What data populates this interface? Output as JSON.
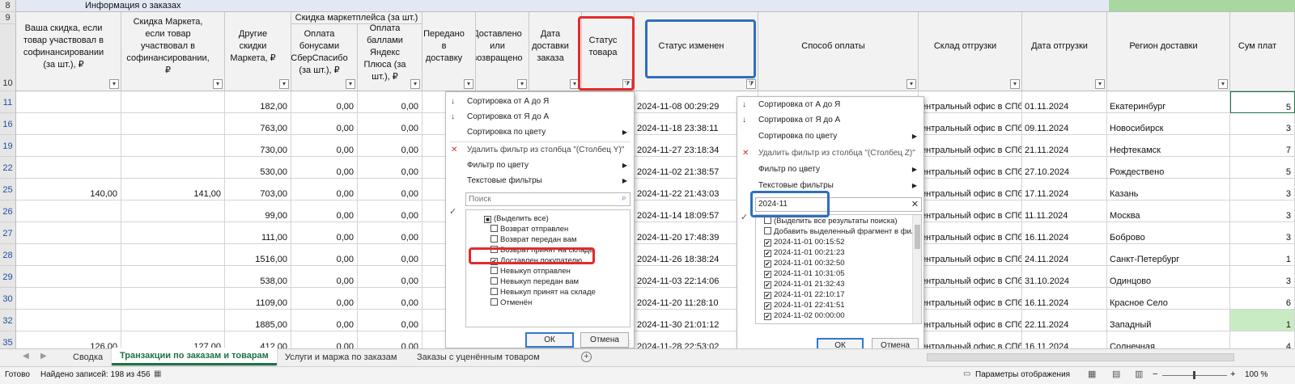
{
  "title_row": {
    "label": "Информация о заказах",
    "row_header": "8"
  },
  "row_headers": {
    "r9": "9",
    "r10": "10"
  },
  "group_header": "Скидка маркетплейса (за шт.)",
  "columns": [
    {
      "label": "Ваша скидка, если товар участвовал в софинансировании (за шт.), ₽"
    },
    {
      "label": "Скидка Маркета, если товар участвовал в софинансировании, ₽"
    },
    {
      "label": "Другие скидки Маркета, ₽"
    },
    {
      "label": "Оплата бонусами СберСпасибо (за шт.), ₽"
    },
    {
      "label": "Оплата баллами Яндекс Плюса (за шт.), ₽"
    },
    {
      "label": "Передано в доставку"
    },
    {
      "label": "Доставлено или возвращено"
    },
    {
      "label": "Дата доставки заказа"
    },
    {
      "label": "Статус товара"
    },
    {
      "label": "Статус изменен"
    },
    {
      "label": "Способ оплаты"
    },
    {
      "label": "Склад отгрузки"
    },
    {
      "label": "Дата отгрузки"
    },
    {
      "label": "Регион доставки"
    },
    {
      "label": "Сум плат"
    }
  ],
  "rows": [
    {
      "num": "11",
      "c1": "",
      "c2": "",
      "c3": "182,00",
      "c4": "0,00",
      "c5": "0,00",
      "changed": "2024-11-08 00:29:29",
      "warehouse": "ентральный офис в СПб",
      "ship": "01.11.2024",
      "region": "Екатеринбург",
      "sum": "5"
    },
    {
      "num": "16",
      "c1": "",
      "c2": "",
      "c3": "763,00",
      "c4": "0,00",
      "c5": "0,00",
      "changed": "2024-11-18 23:38:11",
      "warehouse": "ентральный офис в СПб",
      "ship": "09.11.2024",
      "region": "Новосибирск",
      "sum": "3"
    },
    {
      "num": "19",
      "c1": "",
      "c2": "",
      "c3": "730,00",
      "c4": "0,00",
      "c5": "0,00",
      "changed": "2024-11-27 23:18:34",
      "warehouse": "ентральный офис в СПб",
      "ship": "21.11.2024",
      "region": "Нефтекамск",
      "sum": "7"
    },
    {
      "num": "22",
      "c1": "",
      "c2": "",
      "c3": "530,00",
      "c4": "0,00",
      "c5": "0,00",
      "changed": "2024-11-02 21:38:57",
      "warehouse": "ентральный офис в СПб",
      "ship": "27.10.2024",
      "region": "Рождествено",
      "sum": "5"
    },
    {
      "num": "25",
      "c1": "140,00",
      "c2": "141,00",
      "c3": "703,00",
      "c4": "0,00",
      "c5": "0,00",
      "changed": "2024-11-22 21:43:03",
      "warehouse": "ентральный офис в СПб",
      "ship": "17.11.2024",
      "region": "Казань",
      "sum": "3"
    },
    {
      "num": "26",
      "c1": "",
      "c2": "",
      "c3": "99,00",
      "c4": "0,00",
      "c5": "0,00",
      "changed": "2024-11-14 18:09:57",
      "warehouse": "ентральный офис в СПб",
      "ship": "11.11.2024",
      "region": "Москва",
      "sum": "3"
    },
    {
      "num": "27",
      "c1": "",
      "c2": "",
      "c3": "111,00",
      "c4": "0,00",
      "c5": "0,00",
      "changed": "2024-11-20 17:48:39",
      "warehouse": "ентральный офис в СПб",
      "ship": "16.11.2024",
      "region": "Боброво",
      "sum": "3"
    },
    {
      "num": "28",
      "c1": "",
      "c2": "",
      "c3": "1516,00",
      "c4": "0,00",
      "c5": "0,00",
      "changed": "2024-11-26 18:38:24",
      "warehouse": "ентральный офис в СПб",
      "ship": "24.11.2024",
      "region": "Санкт-Петербург",
      "sum": "1"
    },
    {
      "num": "29",
      "c1": "",
      "c2": "",
      "c3": "538,00",
      "c4": "0,00",
      "c5": "0,00",
      "changed": "2024-11-03 22:14:06",
      "warehouse": "ентральный офис в СПб",
      "ship": "31.10.2024",
      "region": "Одинцово",
      "sum": "3"
    },
    {
      "num": "30",
      "c1": "",
      "c2": "",
      "c3": "1109,00",
      "c4": "0,00",
      "c5": "0,00",
      "changed": "2024-11-20 11:28:10",
      "warehouse": "ентральный офис в СПб",
      "ship": "16.11.2024",
      "region": "Красное Село",
      "sum": "6"
    },
    {
      "num": "32",
      "c1": "",
      "c2": "",
      "c3": "1885,00",
      "c4": "0,00",
      "c5": "0,00",
      "changed": "2024-11-30 21:01:12",
      "warehouse": "ентральный офис в СПб",
      "ship": "22.11.2024",
      "region": "Западный",
      "sum": "1"
    },
    {
      "num": "35",
      "c1": "126,00",
      "c2": "127,00",
      "c3": "412,00",
      "c4": "0,00",
      "c5": "0,00",
      "changed": "2024-11-28 22:53:02",
      "warehouse": "ентральный офис в СПб",
      "ship": "16.11.2024",
      "region": "Солнечная",
      "sum": "4"
    }
  ],
  "menu1": {
    "sort_az": "Сортировка от А до Я",
    "sort_za": "Сортировка от Я до А",
    "sort_color": "Сортировка по цвету",
    "clear_filter": "Удалить фильтр из столбца \"(Столбец Y)\"",
    "filter_color": "Фильтр по цвету",
    "text_filters": "Текстовые фильтры",
    "search_placeholder": "Поиск",
    "items": [
      "(Выделить все)",
      "Возврат отправлен",
      "Возврат передан вам",
      "Возврат принят на складе",
      "Доставлен покупателю",
      "Невыкуп отправлен",
      "Невыкуп передан вам",
      "Невыкуп принят на складе",
      "Отменён"
    ],
    "ok": "ОК",
    "cancel": "Отмена"
  },
  "menu2": {
    "sort_az": "Сортировка от А до Я",
    "sort_za": "Сортировка от Я до А",
    "sort_color": "Сортировка по цвету",
    "clear_filter": "Удалить фильтр из столбца \"(Столбец Z)\"",
    "filter_color": "Фильтр по цвету",
    "text_filters": "Текстовые фильтры",
    "search_value": "2024-11",
    "items": [
      "(Выделить все результаты поиска)",
      "Добавить выделенный фрагмент в фильтр",
      "2024-11-01 00:15:52",
      "2024-11-01 00:21:23",
      "2024-11-01 00:32:50",
      "2024-11-01 10:31:05",
      "2024-11-01 21:32:43",
      "2024-11-01 22:10:17",
      "2024-11-01 22:41:51",
      "2024-11-02 00:00:00"
    ],
    "ok": "ОК",
    "cancel": "Отмена"
  },
  "sheet_tabs": [
    "Сводка",
    "Транзакции по заказам и товарам",
    "Услуги и маржа по заказам",
    "Заказы с уценённым товаром"
  ],
  "active_tab": "Транзакции по заказам и товарам",
  "status": {
    "ready": "Готово",
    "found": "Найдено записей: 198 из 456",
    "display_settings": "Параметры отображения",
    "zoom": "100 %"
  },
  "colors": {
    "header_bg": "#f2f2f2",
    "title_bg": "#e4e8f4",
    "green": "#a8d8a0",
    "red_highlight": "#e22b2b",
    "blue_highlight": "#2f6fbe",
    "active_tab": "#1e7145"
  }
}
